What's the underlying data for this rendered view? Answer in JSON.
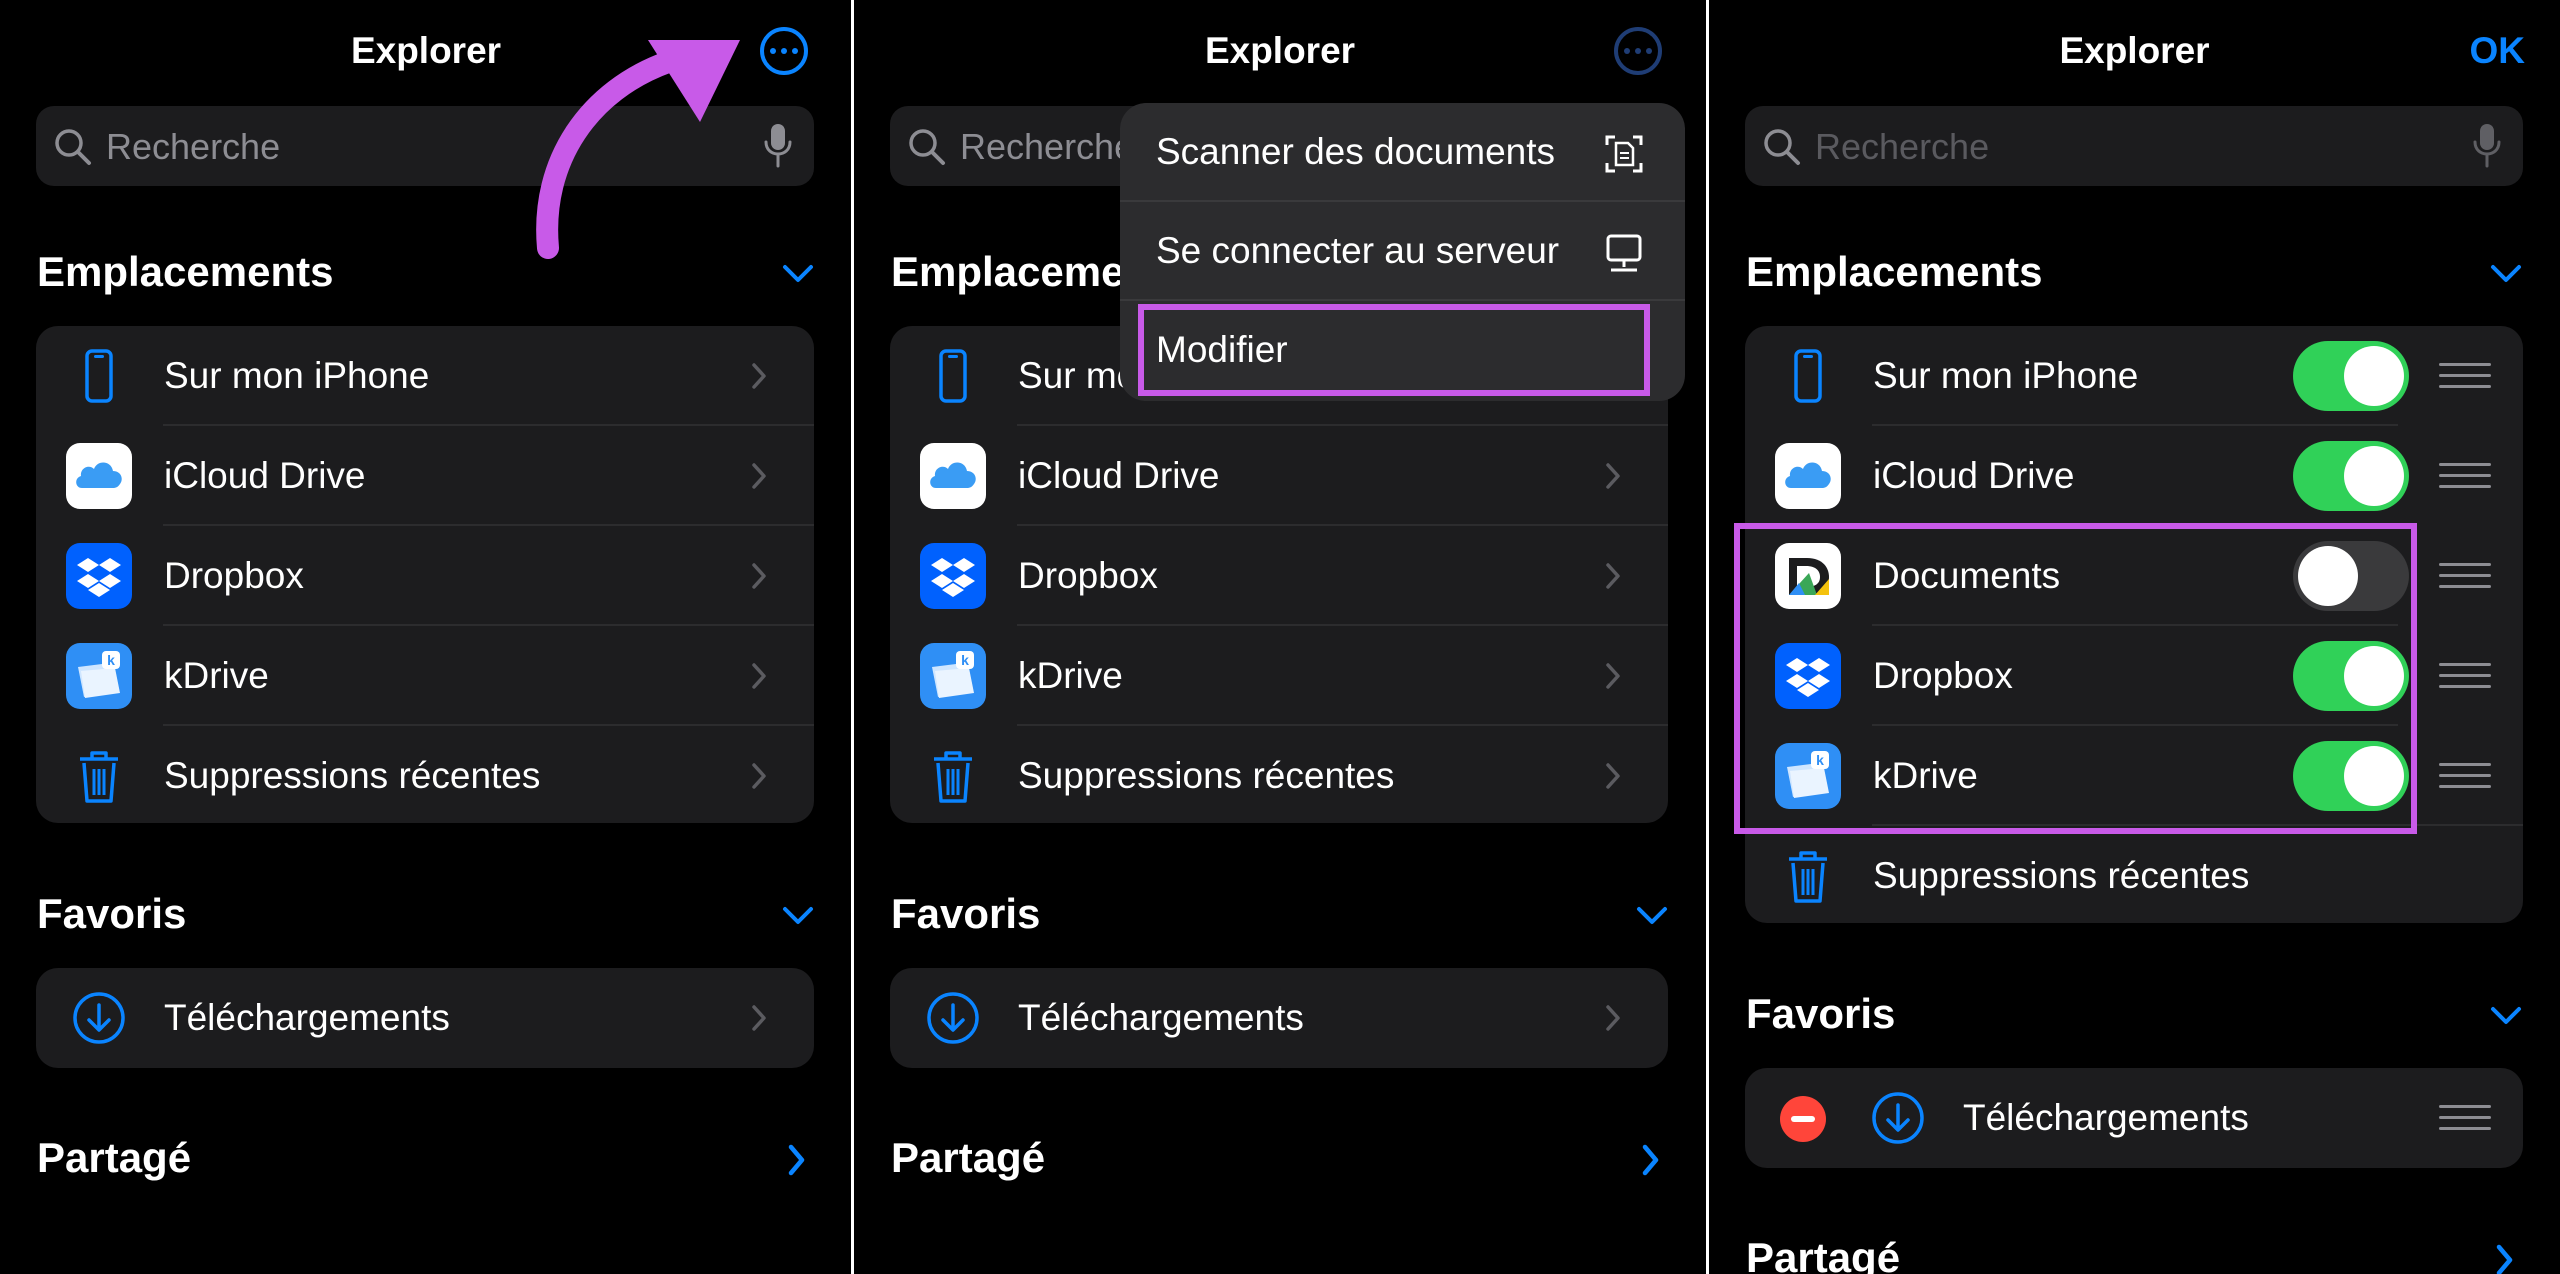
{
  "colors": {
    "accent": "#0a84ff",
    "toggle_on": "#30d158",
    "highlight": "#c85ae8",
    "row_bg": "#1c1c1e",
    "destructive": "#ff453a"
  },
  "panel1": {
    "title": "Explorer",
    "search": {
      "placeholder": "Recherche"
    },
    "sections": {
      "locations": "Emplacements",
      "favorites": "Favoris",
      "shared": "Partagé"
    },
    "locations": [
      {
        "label": "Sur mon iPhone",
        "icon": "iphone-icon"
      },
      {
        "label": "iCloud Drive",
        "icon": "icloud-icon"
      },
      {
        "label": "Dropbox",
        "icon": "dropbox-icon"
      },
      {
        "label": "kDrive",
        "icon": "kdrive-icon"
      },
      {
        "label": "Suppressions récentes",
        "icon": "trash-icon"
      }
    ],
    "favorites": [
      {
        "label": "Téléchargements",
        "icon": "download-icon"
      }
    ]
  },
  "panel2": {
    "title": "Explorer",
    "search": {
      "placeholder": "Recherche"
    },
    "sections": {
      "locations": "Emplacements",
      "favorites": "Favoris",
      "shared": "Partagé"
    },
    "locations": [
      {
        "label": "Sur mon iPhone",
        "icon": "iphone-icon"
      },
      {
        "label": "iCloud Drive",
        "icon": "icloud-icon"
      },
      {
        "label": "Dropbox",
        "icon": "dropbox-icon"
      },
      {
        "label": "kDrive",
        "icon": "kdrive-icon"
      },
      {
        "label": "Suppressions récentes",
        "icon": "trash-icon"
      }
    ],
    "favorites": [
      {
        "label": "Téléchargements",
        "icon": "download-icon"
      }
    ],
    "menu": [
      {
        "label": "Scanner des documents",
        "icon": "scan-document-icon"
      },
      {
        "label": "Se connecter au serveur",
        "icon": "server-icon"
      },
      {
        "label": "Modifier"
      }
    ]
  },
  "panel3": {
    "title": "Explorer",
    "done": "OK",
    "search": {
      "placeholder": "Recherche"
    },
    "sections": {
      "locations": "Emplacements",
      "favorites": "Favoris",
      "shared": "Partagé"
    },
    "locations": [
      {
        "label": "Sur mon iPhone",
        "icon": "iphone-icon",
        "enabled": true
      },
      {
        "label": "iCloud Drive",
        "icon": "icloud-icon",
        "enabled": true
      },
      {
        "label": "Documents",
        "icon": "documents-app-icon",
        "enabled": false
      },
      {
        "label": "Dropbox",
        "icon": "dropbox-icon",
        "enabled": true
      },
      {
        "label": "kDrive",
        "icon": "kdrive-icon",
        "enabled": true
      },
      {
        "label": "Suppressions récentes",
        "icon": "trash-icon"
      }
    ],
    "favorites": [
      {
        "label": "Téléchargements",
        "icon": "download-icon"
      }
    ]
  }
}
